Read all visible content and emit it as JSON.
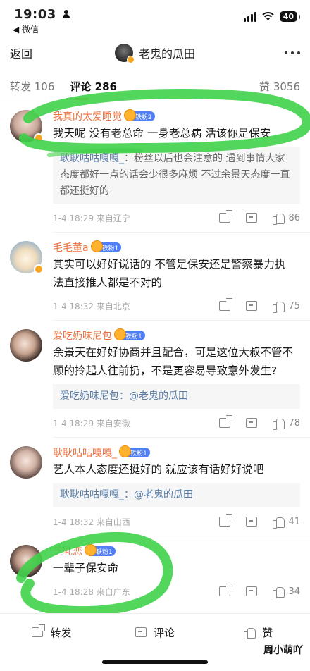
{
  "status_bar": {
    "time": "19:03",
    "back_app": "◀ 微信",
    "battery": "40"
  },
  "nav": {
    "back": "返回",
    "title": "老鬼的瓜田"
  },
  "tabs": {
    "repost": "转发 106",
    "comments": "评论 286",
    "likes": "赞 3056"
  },
  "comments": [
    {
      "name": "我真的太爱睡觉",
      "fan_badge": "铁粉2",
      "text": "我天呢 没有老总命 一身老总病 活该你是保安",
      "reply_name": "耿耿咕咕嘎嘎_",
      "reply_text": "：粉丝以后也会注意的 遇到事情大家态度都好一点的话会少很多麻烦 不过余景天态度一直都还挺好的",
      "meta": "1-4 18:29  来自辽宁",
      "likes": "86"
    },
    {
      "name": "毛毛董a",
      "fan_badge": "铁粉1",
      "text": "其实可以好好说话的 不管是保安还是警察暴力执法直接推人都是不对的",
      "meta": "1-4 18:32  来自北京",
      "likes": "75"
    },
    {
      "name": "爱吃奶味尼包",
      "fan_badge": "铁粉1",
      "text": "余景天在好好协商并且配合，可是这位大叔不管不顾的拎起人往前扔，不是更容易导致意外发生?",
      "reply_name": "爱吃奶味尼包",
      "reply_text": "：@老鬼的瓜田",
      "meta": "1-4 18:29  来自安徽",
      "likes": "78"
    },
    {
      "name": "耿耿咕咕嘎嘎_",
      "fan_badge": "铁粉1",
      "text": "艺人本人态度还挺好的 就应该有话好好说吧",
      "reply_name": "耿耿咕咕嘎嘎_",
      "reply_text": "：@老鬼的瓜田",
      "meta": "1-4 18:32  来自山西",
      "likes": "41"
    },
    {
      "name": "芝乳恋",
      "fan_badge": "铁粉1",
      "text": "一辈子保安命",
      "meta": "1-4 18:28  来自广东",
      "likes": "34"
    }
  ],
  "bottom_bar": {
    "repost": "转发",
    "comment": "评论",
    "like": "赞"
  },
  "watermark": "周小萌吖",
  "colors": {
    "username": "#eb7340",
    "reply_name": "#5a7ea8",
    "tab_indicator": "#ff8200",
    "highlight_marker": "#3fd14a"
  }
}
